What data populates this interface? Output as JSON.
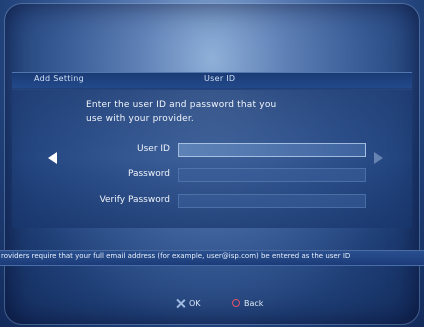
{
  "header": {
    "title_left": "Add Setting",
    "title_center": "User ID"
  },
  "instructions": {
    "line1": "Enter the user ID and password that you",
    "line2": "use with your provider."
  },
  "form": {
    "user_id_label": "User ID",
    "password_label": "Password",
    "verify_password_label": "Verify Password",
    "user_id_value": "",
    "password_value": "",
    "verify_password_value": ""
  },
  "note": "roviders require that your full email address (for example, user@isp.com) be entered as the user ID",
  "footer": {
    "ok_label": "OK",
    "back_label": "Back"
  },
  "icons": {
    "prev": "left-arrow-icon",
    "next": "right-arrow-icon",
    "ok": "cross-button-icon",
    "back": "circle-button-icon"
  }
}
